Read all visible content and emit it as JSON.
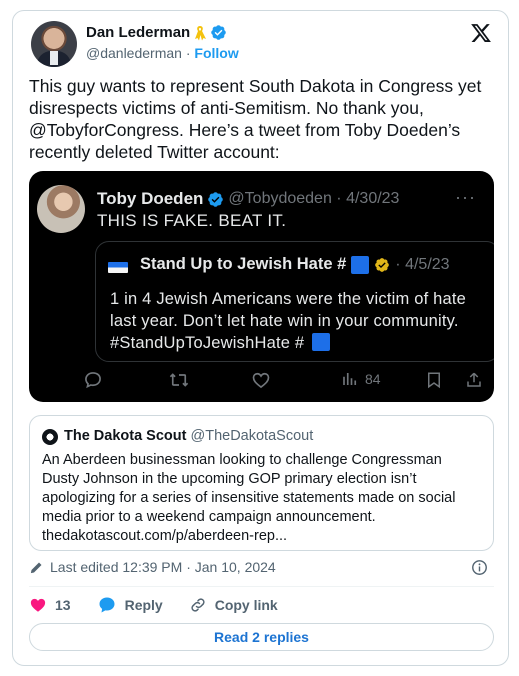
{
  "author": {
    "name": "Dan Lederman",
    "handle": "@danlederman",
    "separator": "·",
    "follow_label": "Follow"
  },
  "tweet": {
    "text": "This guy wants to represent South Dakota in Congress yet disrespects victims of anti-Semitism. No thank you, @TobyforCongress. Here’s a tweet from Toby Doeden’s recently deleted Twitter account:"
  },
  "embedded_screenshot": {
    "name": "Toby Doeden",
    "meta": "@Tobydoeden · 4/30/23",
    "more": "···",
    "text": "THIS IS FAKE. BEAT IT.",
    "quoted": {
      "title": "Stand Up to Jewish Hate #",
      "date": "· 4/5/23",
      "text": "1 in 4 Jewish Americans were the victim of hate last year. Don’t let hate win in your community. #StandUpToJewishHate #"
    },
    "views": "84"
  },
  "quote_card": {
    "name": "The Dakota Scout",
    "handle": "@TheDakotaScout",
    "text": "An Aberdeen businessman looking to challenge Congressman Dusty Johnson in the upcoming GOP primary election isn’t apologizing for a series of insensitive statements made on social media prior to a weekend campaign announcement. thedakotascout.com/p/aberdeen-rep..."
  },
  "edited": {
    "label": "Last edited 12:39 PM · Jan 10, 2024"
  },
  "actions": {
    "like_count": "13",
    "reply_label": "Reply",
    "copy_link_label": "Copy link"
  },
  "read_replies_label": "Read 2 replies",
  "colors": {
    "accent": "#1d9bf0",
    "like": "#f91880",
    "text": "#0f1419",
    "muted": "#536471"
  }
}
